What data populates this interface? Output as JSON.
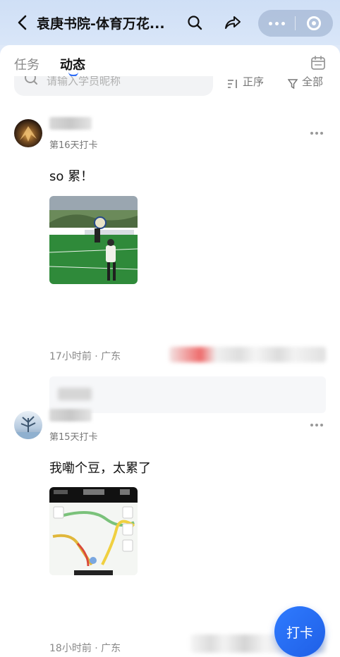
{
  "navbar": {
    "title": "袁庚书院-体育万花...",
    "icons": [
      "back-icon",
      "search-icon",
      "share-icon",
      "more-icon",
      "close-icon"
    ]
  },
  "tabs": [
    {
      "label": "任务",
      "active": false
    },
    {
      "label": "动态",
      "active": true
    }
  ],
  "search": {
    "placeholder": "请输入学员昵称"
  },
  "toolbar": {
    "sort_label": "正序",
    "filter_label": "全部"
  },
  "posts": [
    {
      "streak": "第16天打卡",
      "text": "so 累！",
      "meta": "17小时前 · 广东"
    },
    {
      "streak": "第15天打卡",
      "text": "我嘞个豆，太累了",
      "meta": "18小时前 · 广东"
    }
  ],
  "fab": {
    "label": "打卡"
  },
  "colors": {
    "accent": "#2f6df6",
    "fab": "#2570f5",
    "muted": "#888888"
  }
}
